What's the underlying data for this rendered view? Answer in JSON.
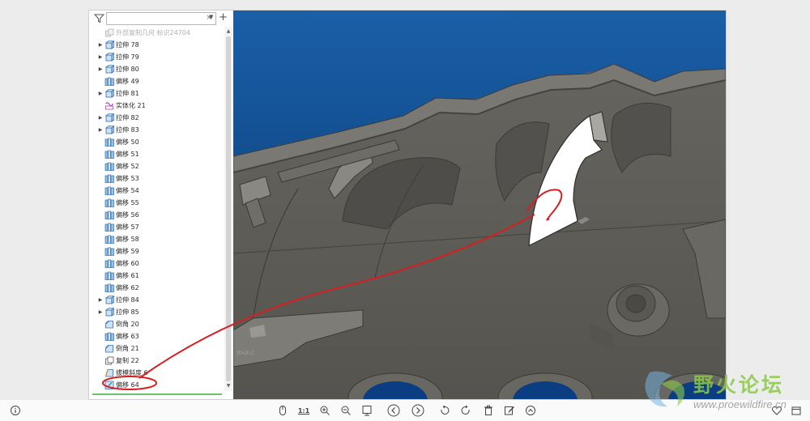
{
  "search": {
    "placeholder": "",
    "value": ""
  },
  "tree": {
    "items": [
      {
        "label": "外部复制几何 标识24704",
        "icon": "copy-geometry-icon",
        "expandable": false,
        "faded": true
      },
      {
        "label": "拉伸 78",
        "icon": "extrude-icon",
        "expandable": true
      },
      {
        "label": "拉伸 79",
        "icon": "extrude-icon",
        "expandable": true
      },
      {
        "label": "拉伸 80",
        "icon": "extrude-icon",
        "expandable": true
      },
      {
        "label": "偏移 49",
        "icon": "offset-icon",
        "expandable": false
      },
      {
        "label": "拉伸 81",
        "icon": "extrude-icon",
        "expandable": true
      },
      {
        "label": "实体化 21",
        "icon": "solidify-icon",
        "expandable": false
      },
      {
        "label": "拉伸 82",
        "icon": "extrude-icon",
        "expandable": true
      },
      {
        "label": "拉伸 83",
        "icon": "extrude-icon",
        "expandable": true
      },
      {
        "label": "偏移 50",
        "icon": "offset-icon",
        "expandable": false
      },
      {
        "label": "偏移 51",
        "icon": "offset-icon",
        "expandable": false
      },
      {
        "label": "偏移 52",
        "icon": "offset-icon",
        "expandable": false
      },
      {
        "label": "偏移 53",
        "icon": "offset-icon",
        "expandable": false
      },
      {
        "label": "偏移 54",
        "icon": "offset-icon",
        "expandable": false
      },
      {
        "label": "偏移 55",
        "icon": "offset-icon",
        "expandable": false
      },
      {
        "label": "偏移 56",
        "icon": "offset-icon",
        "expandable": false
      },
      {
        "label": "偏移 57",
        "icon": "offset-icon",
        "expandable": false
      },
      {
        "label": "偏移 58",
        "icon": "offset-icon",
        "expandable": false
      },
      {
        "label": "偏移 59",
        "icon": "offset-icon",
        "expandable": false
      },
      {
        "label": "偏移 60",
        "icon": "offset-icon",
        "expandable": false
      },
      {
        "label": "偏移 61",
        "icon": "offset-icon",
        "expandable": false
      },
      {
        "label": "偏移 62",
        "icon": "offset-icon",
        "expandable": false
      },
      {
        "label": "拉伸 84",
        "icon": "extrude-icon",
        "expandable": true
      },
      {
        "label": "拉伸 85",
        "icon": "extrude-icon",
        "expandable": true
      },
      {
        "label": "倒角 20",
        "icon": "chamfer-icon",
        "expandable": false
      },
      {
        "label": "偏移 63",
        "icon": "offset-icon",
        "expandable": false
      },
      {
        "label": "倒角 21",
        "icon": "chamfer-icon",
        "expandable": false
      },
      {
        "label": "复制 22",
        "icon": "copy-icon",
        "expandable": false
      },
      {
        "label": "拔模斜度 6",
        "icon": "draft-icon",
        "expandable": false
      },
      {
        "label": "偏移 64",
        "icon": "offset-highlight-icon",
        "expandable": false
      }
    ]
  },
  "viewport": {
    "corner_label": "替A表式"
  },
  "toolbar": {
    "zoom_label": "1:1"
  },
  "watermark": {
    "title": "野火论坛",
    "url": "www.proewildfire.cn"
  },
  "colors": {
    "background_top": "#1a5fa8",
    "background_bottom": "#073469",
    "model_gray": "#5b5a56",
    "highlight_surface": "#ffffff",
    "annotation_red": "#d42020",
    "accent_green": "#6cc16c"
  }
}
